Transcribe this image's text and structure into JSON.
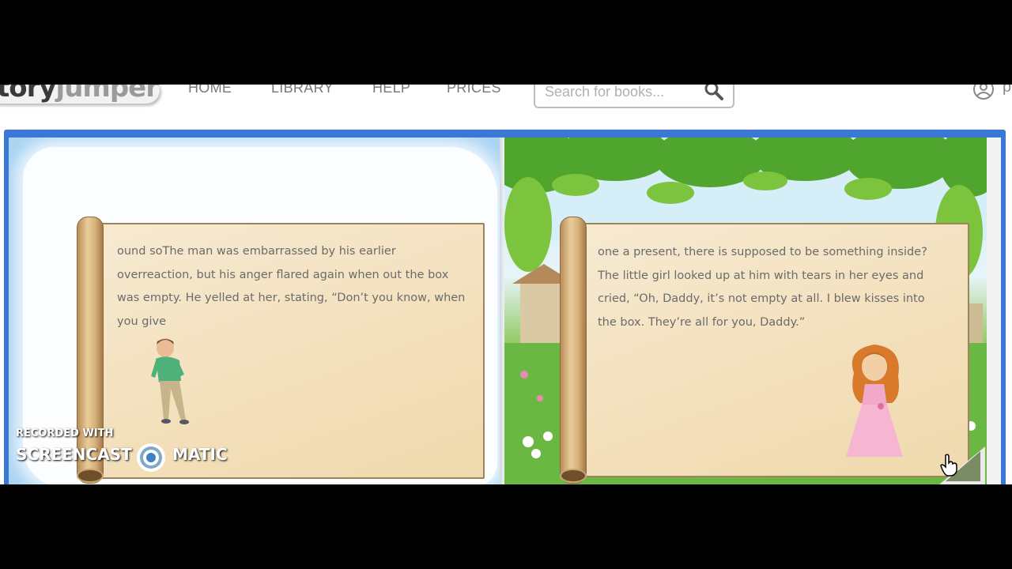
{
  "logo": {
    "part1": "tory",
    "part2": "jumper"
  },
  "nav": {
    "items": [
      "HOME",
      "LIBRARY",
      "HELP",
      "PRICES"
    ]
  },
  "search": {
    "placeholder": "Search for books...",
    "icon": "search-icon"
  },
  "user": {
    "label": "p",
    "icon": "user-icon"
  },
  "left_page": {
    "lines": [
      "ound soThe man was embarrassed by his earlier",
      "overreaction, but his anger flared again when out the box",
      "was empty. He yelled at her, stating, “Don’t you know, when",
      "you give"
    ]
  },
  "right_page": {
    "lines": [
      "one a present, there is supposed to be something inside?",
      "The little girl looked up at him with tears in her eyes and",
      "cried, “Oh, Daddy, it’s not empty at all. I blew kisses into",
      "the box. They’re all for you, Daddy.”"
    ]
  },
  "watermark": {
    "recorded": "RECORDED WITH",
    "screencast": "SCREENCAST",
    "matic": "MATIC"
  },
  "colors": {
    "book_border": "#3b78d6",
    "nav_text": "#777777",
    "story_text": "#6b6b6b"
  }
}
